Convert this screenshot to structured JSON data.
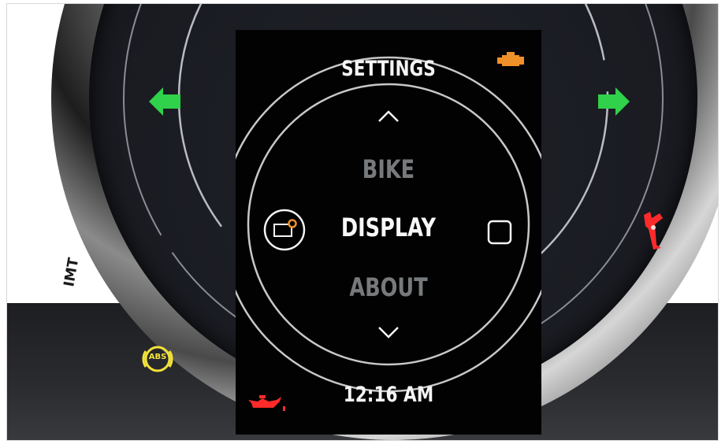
{
  "screen": {
    "title": "SETTINGS",
    "menu": {
      "previous": "BIKE",
      "selected": "DISPLAY",
      "next": "ABOUT"
    },
    "clock": "12:16 AM"
  },
  "indicators": {
    "abs_label": "ABS"
  },
  "icons": {
    "check_engine": "check-engine-icon",
    "oil": "oil-pressure-icon",
    "left_turn": "left-turn-signal-icon",
    "right_turn": "right-turn-signal-icon",
    "kickstand": "kickstand-icon",
    "abs": "abs-warning-icon",
    "display_settings": "display-settings-icon",
    "select": "select-square-icon",
    "up": "chevron-up-icon",
    "down": "chevron-down-icon"
  },
  "colors": {
    "turn_signal": "#2fd24a",
    "warning_red": "#ff2a2a",
    "abs_yellow": "#f2e23a",
    "engine_orange": "#f0902a",
    "text_primary": "#f8f8f8",
    "text_dim": "#777a7d"
  }
}
